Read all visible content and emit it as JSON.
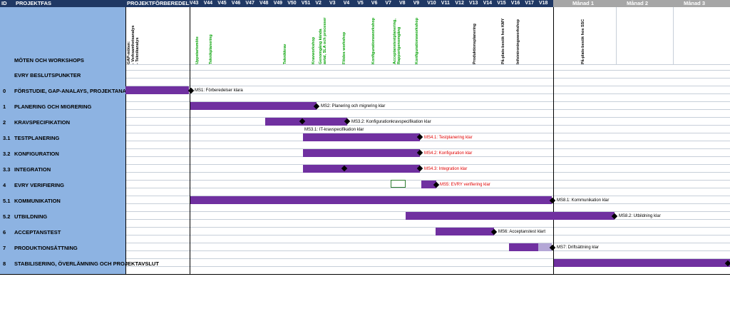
{
  "header": {
    "id_label": "ID",
    "phase_label": "PROJEKTFAS",
    "prep_label": "PROJEKTFÖRBEREDELSER",
    "weeks": [
      "V43",
      "V44",
      "V45",
      "V46",
      "V47",
      "V48",
      "V49",
      "V50",
      "V51",
      "V2",
      "V3",
      "V4",
      "V5",
      "V6",
      "V7",
      "V8",
      "V9",
      "V10",
      "V11",
      "V12",
      "V13",
      "V14",
      "V15",
      "V16",
      "V17",
      "V18"
    ],
    "months": [
      "Månad 1",
      "Månad 2",
      "Månad 3"
    ]
  },
  "meetings": [
    {
      "text": "GAP-möten:\n- Verksamhetsanalys\n- Teknikanalys",
      "color": "#000000"
    },
    {
      "text": "Uppstartsmöte",
      "color": "#00a000"
    },
    {
      "text": "Teknikplanering",
      "color": "#00a000"
    },
    {
      "text": "Teknikkrav",
      "color": "#00a000"
    },
    {
      "text": "Kravworkshop",
      "color": "#00a000"
    },
    {
      "text": "Genomgång kända\navtal, SLA och processer",
      "color": "#00a000"
    },
    {
      "text": "Flödes workshop",
      "color": "#00a000"
    },
    {
      "text": "Konfigurationsworkshop",
      "color": "#00a000"
    },
    {
      "text": "Acceptanstestplanering,\nRapportgenomgång",
      "color": "#00a000"
    },
    {
      "text": "Konfigurationsworkshop",
      "color": "#00a000"
    },
    {
      "text": "Produktionsplanering",
      "color": "#000000"
    },
    {
      "text": "På-plats-besök hos KMY",
      "color": "#000000"
    },
    {
      "text": "Infointroningsworkshop",
      "color": "#000000"
    },
    {
      "text": "På-plats-besök hos SSC",
      "color": "#000000"
    }
  ],
  "rows": [
    {
      "id": "",
      "name": "MÖTEN OCH WORKSHOPS"
    },
    {
      "id": "",
      "name": "EVRY BESLUTSPUNKTER"
    },
    {
      "id": "0",
      "name": "FÖRSTUDIE, GAP-ANALAYS, PROJEKTANALYS OCH AVTAL"
    },
    {
      "id": "1",
      "name": "PLANERING OCH MIGRERING"
    },
    {
      "id": "2",
      "name": "KRAVSPECIFIKATION"
    },
    {
      "id": "3.1",
      "name": "TESTPLANERING"
    },
    {
      "id": "3.2",
      "name": "KONFIGURATION"
    },
    {
      "id": "3.3",
      "name": "INTEGRATION"
    },
    {
      "id": "4",
      "name": "EVRY VERIFIERING"
    },
    {
      "id": "5.1",
      "name": "KOMMUNIKATION"
    },
    {
      "id": "5.2",
      "name": "UTBILDNING"
    },
    {
      "id": "6",
      "name": "ACCEPTANSTEST"
    },
    {
      "id": "7",
      "name": "PRODUKTIONSÄTTNING"
    },
    {
      "id": "8",
      "name": "STABILISERING, ÖVERLÄMNING OCH PROJEKTAVSLUT"
    }
  ],
  "milestones": [
    "MS1: Förberedelser klara",
    "MS2: Planering och migrering klar",
    "MS3.2: Konfigurationkravspecifikation klar",
    "MS3.1: IT-kravspecifikation klar",
    "MS4.1: Testplanering klar",
    "MS4.2: Konfiguration klar",
    "MS4.3: Integration klar",
    "MS5: EVRY verifiering klar",
    "MS8.1: Kommunikation klar",
    "MS8.2: Utbildning klar",
    "MS6: Acceptanstest klart",
    "MS7: Driftsättning klar"
  ],
  "colors": {
    "header_bg": "#8db3e2",
    "header_dark": "#1f3864",
    "months_bg": "#a6a6a6",
    "label_col": "#8db3e2",
    "bar": "#7030a0",
    "bar_light": "#b4a7d6",
    "ms_red": "#e00000"
  }
}
